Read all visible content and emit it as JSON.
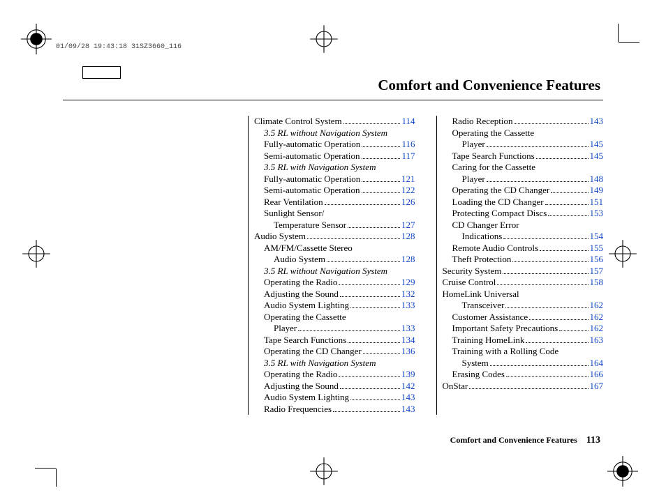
{
  "stamp": "01/09/28 19:43:18 31SZ3660_116",
  "title": "Comfort and Convenience Features",
  "footer_text": "Comfort and Convenience Features",
  "footer_page": "113",
  "col1": [
    {
      "label": "Climate Control System",
      "page": "114",
      "indent": 0
    },
    {
      "label": "3.5 RL without Navigation System",
      "italic": true,
      "indent": 1
    },
    {
      "label": "Fully-automatic Operation",
      "page": "116",
      "indent": 1
    },
    {
      "label": "Semi-automatic Operation",
      "page": "117",
      "indent": 1
    },
    {
      "label": "3.5 RL with Navigation System",
      "italic": true,
      "indent": 1
    },
    {
      "label": "Fully-automatic Operation",
      "page": "121",
      "indent": 1
    },
    {
      "label": "Semi-automatic Operation",
      "page": "122",
      "indent": 1
    },
    {
      "label": "Rear Ventilation",
      "page": "126",
      "indent": 1
    },
    {
      "label": "Sunlight Sensor/",
      "indent": 1
    },
    {
      "label": "Temperature Sensor",
      "page": "127",
      "indent": 2
    },
    {
      "label": "Audio System",
      "page": "128",
      "indent": 0
    },
    {
      "label": "AM/FM/Cassette Stereo",
      "indent": 1
    },
    {
      "label": "Audio System",
      "page": "128",
      "indent": 2
    },
    {
      "label": "3.5 RL without Navigation System",
      "italic": true,
      "indent": 1
    },
    {
      "label": "Operating the Radio",
      "page": "129",
      "indent": 1
    },
    {
      "label": "Adjusting the Sound",
      "page": "132",
      "indent": 1
    },
    {
      "label": "Audio System Lighting",
      "page": "133",
      "indent": 1
    },
    {
      "label": "Operating the Cassette",
      "indent": 1
    },
    {
      "label": "Player",
      "page": "133",
      "indent": 2
    },
    {
      "label": "Tape Search Functions",
      "page": "134",
      "indent": 1
    },
    {
      "label": "Operating the CD Changer",
      "page": "136",
      "indent": 1
    },
    {
      "label": "3.5 RL with Navigation System",
      "italic": true,
      "indent": 1
    },
    {
      "label": "Operating the Radio",
      "page": "139",
      "indent": 1
    },
    {
      "label": "Adjusting the Sound",
      "page": "142",
      "indent": 1
    },
    {
      "label": "Audio System Lighting",
      "page": "143",
      "indent": 1
    },
    {
      "label": "Radio Frequencies",
      "page": "143",
      "indent": 1
    }
  ],
  "col2": [
    {
      "label": "Radio Reception",
      "page": "143",
      "indent": 1
    },
    {
      "label": "Operating the Cassette",
      "indent": 1
    },
    {
      "label": "Player",
      "page": "145",
      "indent": 2
    },
    {
      "label": "Tape Search Functions",
      "page": "145",
      "indent": 1
    },
    {
      "label": "Caring for the Cassette",
      "indent": 1
    },
    {
      "label": "Player",
      "page": "148",
      "indent": 2
    },
    {
      "label": "Operating the CD Changer",
      "page": "149",
      "indent": 1
    },
    {
      "label": "Loading the CD Changer",
      "page": "151",
      "indent": 1
    },
    {
      "label": "Protecting Compact Discs",
      "page": "153",
      "indent": 1
    },
    {
      "label": "CD Changer Error",
      "indent": 1
    },
    {
      "label": "Indications",
      "page": "154",
      "indent": 2
    },
    {
      "label": "Remote Audio Controls",
      "page": "155",
      "indent": 1
    },
    {
      "label": "Theft Protection",
      "page": "156",
      "indent": 1
    },
    {
      "label": "Security System",
      "page": "157",
      "indent": 0
    },
    {
      "label": "Cruise Control",
      "page": "158",
      "indent": 0
    },
    {
      "label": "HomeLink Universal",
      "indent": 0
    },
    {
      "label": "Transceiver",
      "page": "162",
      "indent": 2
    },
    {
      "label": "Customer Assistance",
      "page": "162",
      "indent": 1
    },
    {
      "label": "Important Safety Precautions",
      "page": "162",
      "indent": 1
    },
    {
      "label": "Training HomeLink",
      "page": "163",
      "indent": 1
    },
    {
      "label": "Training with a Rolling Code",
      "indent": 1
    },
    {
      "label": "System",
      "page": "164",
      "indent": 2
    },
    {
      "label": "Erasing Codes",
      "page": "166",
      "indent": 1
    },
    {
      "label": "OnStar",
      "page": "167",
      "indent": 0
    }
  ]
}
